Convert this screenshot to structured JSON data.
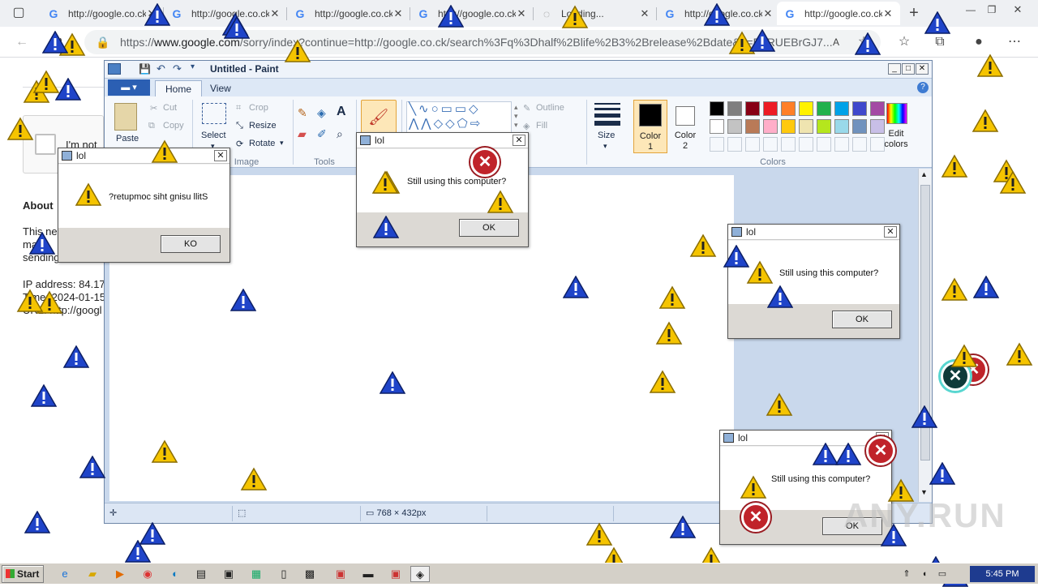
{
  "browser": {
    "tabs": [
      {
        "title": "http://google.co.ck"
      },
      {
        "title": "http://google.co.ck"
      },
      {
        "title": "http://google.co.ck"
      },
      {
        "title": "http://google.co.ck"
      },
      {
        "title": "Loading..."
      },
      {
        "title": "http://google.co.ck"
      },
      {
        "title": "http://google.co.ck"
      }
    ],
    "url_prefix": "https://",
    "url_host": "www.google.com",
    "url_rest": "/sorry/index?continue=http://google.co.ck/search%3Fq%3Dhalf%2Blife%2B3%2Brelease%2Bdate&q=EgRUEBrGJ7..."
  },
  "google_page": {
    "captcha_text": "I'm not",
    "about_heading": "About",
    "text_lines": [
      "This ne",
      "ma",
      "sending"
    ],
    "ip_line": "IP address: 84.17",
    "time_line": "Time: 2024-01-15",
    "url_line": "URL: http://googl"
  },
  "paint": {
    "title": "Untitled - Paint",
    "tabs": {
      "home": "Home",
      "view": "View"
    },
    "clipboard": {
      "paste": "Paste",
      "cut": "Cut",
      "copy": "Copy"
    },
    "image": {
      "select": "Select",
      "crop": "Crop",
      "resize": "Resize",
      "rotate": "Rotate",
      "label": "Image"
    },
    "tools_label": "Tools",
    "shapes": {
      "outline": "Outline",
      "fill": "Fill"
    },
    "size_label": "Size",
    "color1_label": "Color\n1",
    "color2_label": "Color\n2",
    "colors_label": "Colors",
    "edit_colors": "Edit\ncolors",
    "palette_row1": [
      "#000000",
      "#7f7f7f",
      "#880015",
      "#ed1c24",
      "#ff7f27",
      "#fff200",
      "#22b14c",
      "#00a2e8",
      "#3f48cc",
      "#a349a4"
    ],
    "palette_row2": [
      "#ffffff",
      "#c3c3c3",
      "#b97a57",
      "#ffaec9",
      "#ffc90e",
      "#efe4b0",
      "#b5e61d",
      "#99d9ea",
      "#7092be",
      "#c8bfe7"
    ],
    "status_size": "768 × 432px"
  },
  "dialogs": [
    {
      "title": "lol",
      "message": "?retupmoc siht gnisu llitS",
      "button": "KO"
    },
    {
      "title": "lol",
      "message": "Still using this computer?",
      "button": "OK"
    },
    {
      "title": "lol",
      "message": "Still using this computer?",
      "button": "OK"
    },
    {
      "title": "lol",
      "message": "Still using this computer?",
      "button": "OK"
    }
  ],
  "taskbar": {
    "start_label": "Start",
    "clock": "5:45 PM"
  },
  "watermark": "ANY.RUN",
  "colors": {
    "warning_yellow": "#f5c400",
    "warning_blue": "#1f44c9",
    "error_red": "#c0232a"
  }
}
